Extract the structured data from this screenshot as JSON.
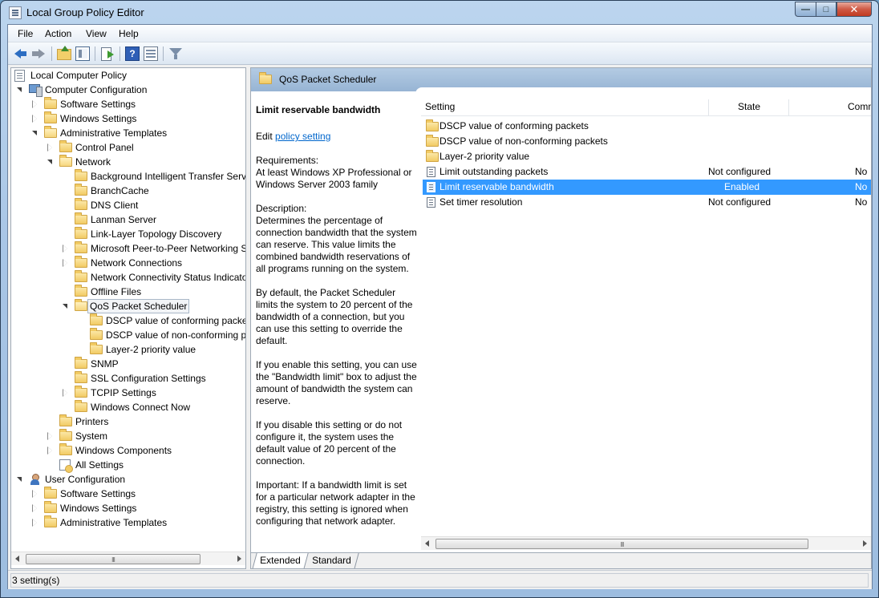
{
  "window": {
    "title": "Local Group Policy Editor",
    "icon": "policy-editor-icon",
    "controls": [
      "minimize-icon",
      "maximize-icon",
      "close-icon"
    ]
  },
  "menu": {
    "file": "File",
    "action": "Action",
    "view": "View",
    "help": "Help"
  },
  "toolbar": {
    "icons": [
      "back-arrow-icon",
      "forward-arrow-icon",
      "up-folder-icon",
      "show-hide-tree-icon",
      "export-list-icon",
      "help-icon",
      "properties-icon",
      "filter-icon"
    ],
    "help_glyph": "?"
  },
  "tree": {
    "root": "Local Computer Policy",
    "computer_config": "Computer Configuration",
    "cc_software": "Software Settings",
    "cc_windows": "Windows Settings",
    "cc_admin": "Administrative Templates",
    "control_panel": "Control Panel",
    "network": "Network",
    "bits": "Background Intelligent Transfer Serv",
    "branchcache": "BranchCache",
    "dns": "DNS Client",
    "lanman": "Lanman Server",
    "lltd": "Link-Layer Topology Discovery",
    "p2p": "Microsoft Peer-to-Peer Networking S",
    "netconn": "Network Connections",
    "ncsi": "Network Connectivity Status Indicato",
    "offline": "Offline Files",
    "qos": "QoS Packet Scheduler",
    "dscp_conf": "DSCP value of conforming packe",
    "dscp_nonconf": "DSCP value of non-conforming p",
    "layer2": "Layer-2 priority value",
    "snmp": "SNMP",
    "ssl": "SSL Configuration Settings",
    "tcpip": "TCPIP Settings",
    "wcn": "Windows Connect Now",
    "printers": "Printers",
    "system": "System",
    "wincomp": "Windows Components",
    "allsettings": "All Settings",
    "user_config": "User Configuration",
    "uc_software": "Software Settings",
    "uc_windows": "Windows Settings",
    "uc_admin": "Administrative Templates"
  },
  "right": {
    "header_title": "QoS Packet Scheduler",
    "desc_title": "Limit reservable bandwidth",
    "edit_prefix": "Edit ",
    "edit_link": "policy setting",
    "description": "Requirements:\nAt least Windows XP Professional or Windows Server 2003 family\n\nDescription:\nDetermines the percentage of connection bandwidth that the system can reserve. This value limits the combined bandwidth reservations of all programs running on the system.\n\nBy default, the Packet Scheduler limits the system to 20 percent of the bandwidth of a connection, but you can use this setting to override the default.\n\nIf you enable this setting, you can use the \"Bandwidth limit\" box to adjust the amount of bandwidth the system can reserve.\n\nIf you disable this setting or do not configure it, the system uses the default value of 20 percent of the connection.\n\nImportant: If a bandwidth limit is set for a particular network adapter in the registry, this setting is ignored when configuring that network adapter."
  },
  "list": {
    "columns": {
      "setting": "Setting",
      "state": "State",
      "comment": "Comme"
    },
    "rows": [
      {
        "name": "DSCP value of conforming packets",
        "state": "",
        "comment": "",
        "type": "folder"
      },
      {
        "name": "DSCP value of non-conforming packets",
        "state": "",
        "comment": "",
        "type": "folder"
      },
      {
        "name": "Layer-2 priority value",
        "state": "",
        "comment": "",
        "type": "folder"
      },
      {
        "name": "Limit outstanding packets",
        "state": "Not configured",
        "comment": "No",
        "type": "setting"
      },
      {
        "name": "Limit reservable bandwidth",
        "state": "Enabled",
        "comment": "No",
        "type": "setting",
        "selected": true
      },
      {
        "name": "Set timer resolution",
        "state": "Not configured",
        "comment": "No",
        "type": "setting"
      }
    ]
  },
  "tabs": {
    "extended": "Extended",
    "standard": "Standard"
  },
  "status": {
    "text": "3 setting(s)"
  },
  "scrollbar_grip": "III"
}
